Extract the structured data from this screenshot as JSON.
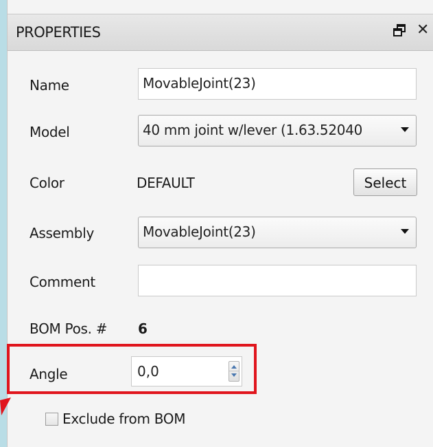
{
  "panel": {
    "title": "PROPERTIES",
    "float_icon": "float-window-icon",
    "close_label": "✕"
  },
  "fields": {
    "name": {
      "label": "Name",
      "value": "MovableJoint(23)"
    },
    "model": {
      "label": "Model",
      "value": "40 mm joint w/lever (1.63.52040"
    },
    "color": {
      "label": "Color",
      "value": "DEFAULT",
      "button": "Select"
    },
    "assembly": {
      "label": "Assembly",
      "value": "MovableJoint(23)"
    },
    "comment": {
      "label": "Comment",
      "value": ""
    },
    "bom_pos": {
      "label": "BOM Pos. #",
      "value": "6"
    },
    "angle": {
      "label": "Angle",
      "value": "0,0"
    },
    "exclude": {
      "label": "Exclude from BOM",
      "checked": false
    }
  },
  "colors": {
    "highlight": "#e0151d",
    "background": "#b9dde6",
    "spin_arrow": "#4a78b0"
  }
}
